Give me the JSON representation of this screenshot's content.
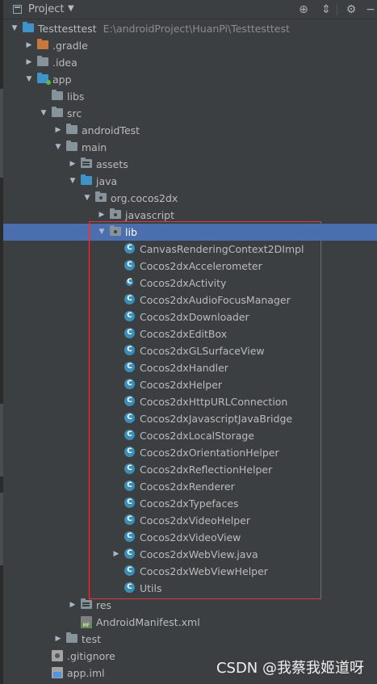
{
  "header": {
    "title": "Project",
    "buttons": [
      "target-icon",
      "collapse-icon",
      "gear-icon",
      "hide-icon"
    ]
  },
  "tree": [
    {
      "label": "Testtesttest",
      "path": "E:\\androidProject\\HuanPi\\Testtesttest",
      "depth": 0,
      "arrow": "expanded",
      "icon": "module-folder-icon"
    },
    {
      "label": ".gradle",
      "depth": 1,
      "arrow": "collapsed",
      "icon": "folder-orange-icon"
    },
    {
      "label": ".idea",
      "depth": 1,
      "arrow": "collapsed",
      "icon": "folder-icon"
    },
    {
      "label": "app",
      "depth": 1,
      "arrow": "expanded",
      "icon": "module-folder-icon"
    },
    {
      "label": "libs",
      "depth": 2,
      "arrow": "none",
      "icon": "folder-icon"
    },
    {
      "label": "src",
      "depth": 2,
      "arrow": "expanded",
      "icon": "folder-icon"
    },
    {
      "label": "androidTest",
      "depth": 3,
      "arrow": "collapsed",
      "icon": "folder-icon"
    },
    {
      "label": "main",
      "depth": 3,
      "arrow": "expanded",
      "icon": "folder-icon"
    },
    {
      "label": "assets",
      "depth": 4,
      "arrow": "collapsed",
      "icon": "resource-folder-icon"
    },
    {
      "label": "java",
      "depth": 4,
      "arrow": "expanded",
      "icon": "source-folder-icon"
    },
    {
      "label": "org.cocos2dx",
      "depth": 5,
      "arrow": "expanded",
      "icon": "package-icon"
    },
    {
      "label": "javascript",
      "depth": 6,
      "arrow": "collapsed",
      "icon": "package-icon"
    },
    {
      "label": "lib",
      "depth": 6,
      "arrow": "expanded",
      "icon": "package-icon",
      "selected": true
    },
    {
      "label": "CanvasRenderingContext2DImpl",
      "depth": 7,
      "arrow": "none",
      "icon": "class-icon"
    },
    {
      "label": "Cocos2dxAccelerometer",
      "depth": 7,
      "arrow": "none",
      "icon": "class-icon"
    },
    {
      "label": "Cocos2dxActivity",
      "depth": 7,
      "arrow": "none",
      "icon": "abstract-class-icon"
    },
    {
      "label": "Cocos2dxAudioFocusManager",
      "depth": 7,
      "arrow": "none",
      "icon": "class-icon"
    },
    {
      "label": "Cocos2dxDownloader",
      "depth": 7,
      "arrow": "none",
      "icon": "class-icon"
    },
    {
      "label": "Cocos2dxEditBox",
      "depth": 7,
      "arrow": "none",
      "icon": "class-icon"
    },
    {
      "label": "Cocos2dxGLSurfaceView",
      "depth": 7,
      "arrow": "none",
      "icon": "class-icon"
    },
    {
      "label": "Cocos2dxHandler",
      "depth": 7,
      "arrow": "none",
      "icon": "class-icon"
    },
    {
      "label": "Cocos2dxHelper",
      "depth": 7,
      "arrow": "none",
      "icon": "class-icon"
    },
    {
      "label": "Cocos2dxHttpURLConnection",
      "depth": 7,
      "arrow": "none",
      "icon": "class-icon"
    },
    {
      "label": "Cocos2dxJavascriptJavaBridge",
      "depth": 7,
      "arrow": "none",
      "icon": "class-icon"
    },
    {
      "label": "Cocos2dxLocalStorage",
      "depth": 7,
      "arrow": "none",
      "icon": "class-icon"
    },
    {
      "label": "Cocos2dxOrientationHelper",
      "depth": 7,
      "arrow": "none",
      "icon": "class-icon"
    },
    {
      "label": "Cocos2dxReflectionHelper",
      "depth": 7,
      "arrow": "none",
      "icon": "class-icon"
    },
    {
      "label": "Cocos2dxRenderer",
      "depth": 7,
      "arrow": "none",
      "icon": "class-icon"
    },
    {
      "label": "Cocos2dxTypefaces",
      "depth": 7,
      "arrow": "none",
      "icon": "class-icon"
    },
    {
      "label": "Cocos2dxVideoHelper",
      "depth": 7,
      "arrow": "none",
      "icon": "class-icon"
    },
    {
      "label": "Cocos2dxVideoView",
      "depth": 7,
      "arrow": "none",
      "icon": "class-icon"
    },
    {
      "label": "Cocos2dxWebView.java",
      "depth": 7,
      "arrow": "collapsed",
      "icon": "class-icon"
    },
    {
      "label": "Cocos2dxWebViewHelper",
      "depth": 7,
      "arrow": "none",
      "icon": "class-icon"
    },
    {
      "label": "Utils",
      "depth": 7,
      "arrow": "none",
      "icon": "class-icon"
    },
    {
      "label": "res",
      "depth": 4,
      "arrow": "collapsed",
      "icon": "resource-folder-icon"
    },
    {
      "label": "AndroidManifest.xml",
      "depth": 4,
      "arrow": "none",
      "icon": "manifest-file-icon"
    },
    {
      "label": "test",
      "depth": 3,
      "arrow": "collapsed",
      "icon": "folder-icon"
    },
    {
      "label": ".gitignore",
      "depth": 2,
      "arrow": "none",
      "icon": "gitignore-file-icon"
    },
    {
      "label": "app.iml",
      "depth": 2,
      "arrow": "none",
      "icon": "iml-file-icon"
    }
  ],
  "watermark": "CSDN @我蔡我姬道呀",
  "colors": {
    "background": "#3c3f41",
    "selection": "#4b6eaf",
    "highlight_border": "#e0393e",
    "class_icon": "#3d8eb5"
  }
}
